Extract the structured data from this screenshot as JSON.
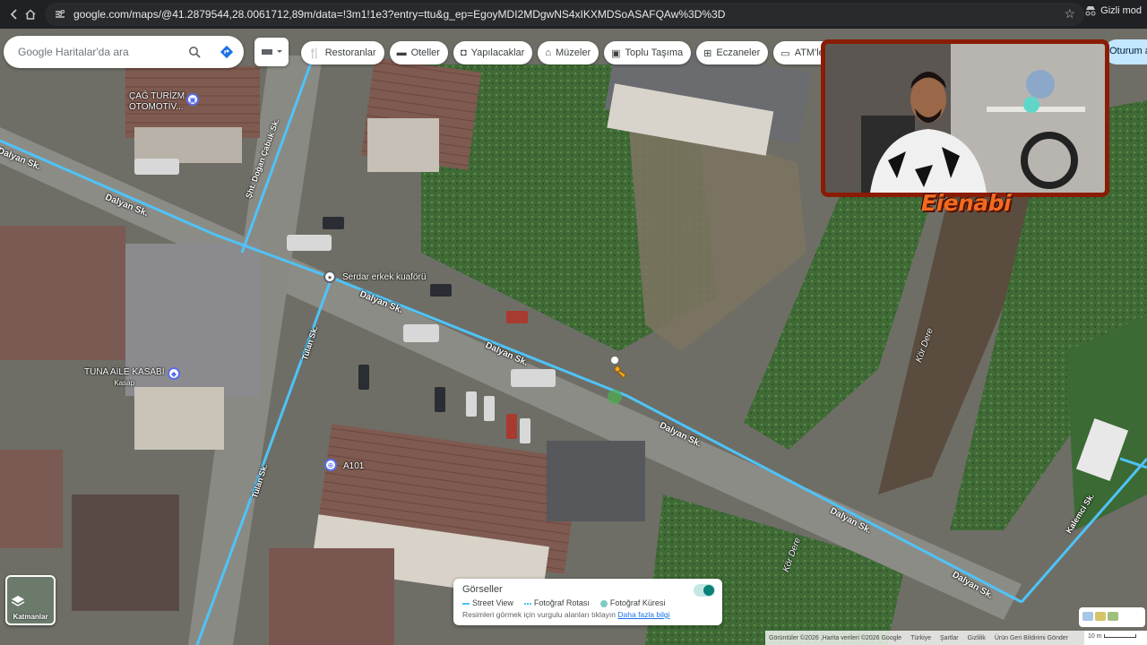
{
  "browser": {
    "url": "google.com/maps/@41.2879544,28.0061712,89m/data=!3m1!1e3?entry=ttu&g_ep=EgoyMDI2MDgwNS4xIKXMDSoASAFQAw%3D%3D",
    "profile_label": "Gizli mod",
    "icons": [
      "chevron-left-icon",
      "home-icon",
      "site-info-icon",
      "star-icon",
      "incognito-icon"
    ]
  },
  "search": {
    "placeholder": "Google Haritalar'da ara"
  },
  "chips": [
    {
      "label": "Restoranlar",
      "icon": "fork-knife-icon"
    },
    {
      "label": "Oteller",
      "icon": "bed-icon"
    },
    {
      "label": "Yapılacaklar",
      "icon": "camera-icon"
    },
    {
      "label": "Müzeler",
      "icon": "museum-icon"
    },
    {
      "label": "Toplu Taşıma",
      "icon": "bus-icon"
    },
    {
      "label": "Eczaneler",
      "icon": "pharmacy-icon"
    },
    {
      "label": "ATM'ler",
      "icon": "atm-icon"
    }
  ],
  "signin_label": "Oturum a",
  "streamer": {
    "logo_text": "Eienabi"
  },
  "places": {
    "cag_turizm_1": "ÇAĞ TURİZM",
    "cag_turizm_2": "OTOMOTİV...",
    "serdar": "Serdar erkek kuaförü",
    "tuna_1": "TUNA AİLE KASABI",
    "tuna_2": "Kasap",
    "a101": "A101"
  },
  "streets": {
    "dalyan_1": "Dalyan Sk.",
    "dalyan_2": "Dalyan Sk.",
    "dalyan_3": "Dalyan Sk.",
    "dalyan_4": "Dalyan Sk.",
    "dalyan_5": "Dalyan Sk.",
    "dalyan_6": "Dalyan Sk.",
    "dalyan_7": "Dalyan Sk.",
    "sht_dogan": "Şht. Doğan Çabuk Sk.",
    "tulan_1": "Tulan Sk.",
    "tulan_2": "Tulan Sk.",
    "kor_dere_1": "Kör Dere",
    "kor_dere_2": "Kör Dere",
    "kalemci": "Kalemci Sk."
  },
  "layers_label": "Katmanlar",
  "gorseller": {
    "title": "Görseller",
    "legend": [
      "Street View",
      "Fotoğraf Rotası",
      "Fotoğraf Küresi"
    ],
    "note": "Resimleri görmek için vurgulu alanları tıklayın",
    "link": "Daha fazla bilgi"
  },
  "footer": {
    "attribution": "Görüntüler ©2026 ,Harita verileri ©2026 Google",
    "items": [
      "Türkiye",
      "Şartlar",
      "Gizlilik",
      "Ürün Geri Bildirimi Gönder"
    ],
    "scale": "10 m"
  },
  "colors": {
    "street_view_line": "#4fc3f7",
    "accent_blue": "#1a73e8",
    "stream_frame": "#8a1c05",
    "logo_orange": "#f26a21"
  }
}
